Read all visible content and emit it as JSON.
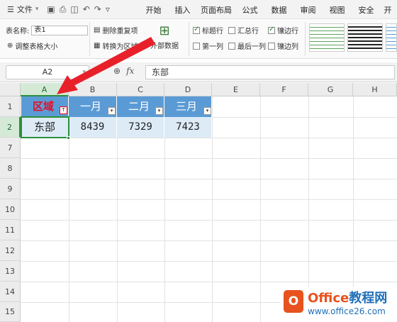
{
  "menubar": {
    "menu_label": "文件",
    "tabs": [
      "开始",
      "插入",
      "页面布局",
      "公式",
      "数据",
      "审阅",
      "视图",
      "安全",
      "开"
    ]
  },
  "ribbon": {
    "table_name_label": "表名称:",
    "table_name_value": "表1",
    "resize_table": "调整表格大小",
    "remove_duplicates": "删除重复项",
    "convert_to_range": "转换为区域",
    "external_data": "外部数据",
    "header_row": "标题行",
    "total_row": "汇总行",
    "banded_rows": "镶边行",
    "first_column": "第一列",
    "last_column": "最后一列",
    "banded_columns": "镶边列",
    "checked": {
      "header_row": true,
      "total_row": false,
      "banded_rows": true,
      "first_column": false,
      "last_column": false,
      "banded_columns": false
    }
  },
  "formula_bar": {
    "cell_ref": "A2",
    "fx": "fx",
    "content": "东部"
  },
  "sheet": {
    "columns": [
      "A",
      "B",
      "C",
      "D",
      "E",
      "F",
      "G",
      "H"
    ],
    "rows": [
      "1",
      "2",
      "7",
      "8",
      "9",
      "10",
      "11",
      "12",
      "13",
      "14",
      "15"
    ],
    "table_headers": [
      "区域",
      "一月",
      "二月",
      "三月"
    ],
    "table_row": [
      "东部",
      "8439",
      "7329",
      "7423"
    ]
  },
  "watermark": {
    "title_a": "Office",
    "title_b": "教程网",
    "url": "www.office26.com",
    "logo_letter": "O"
  },
  "colors": {
    "table_header": "#5b9bd5",
    "table_body": "#ddebf7",
    "filter_active_text": "#e0102a",
    "selection": "#2d8f3c",
    "arrow": "#e8202a"
  }
}
